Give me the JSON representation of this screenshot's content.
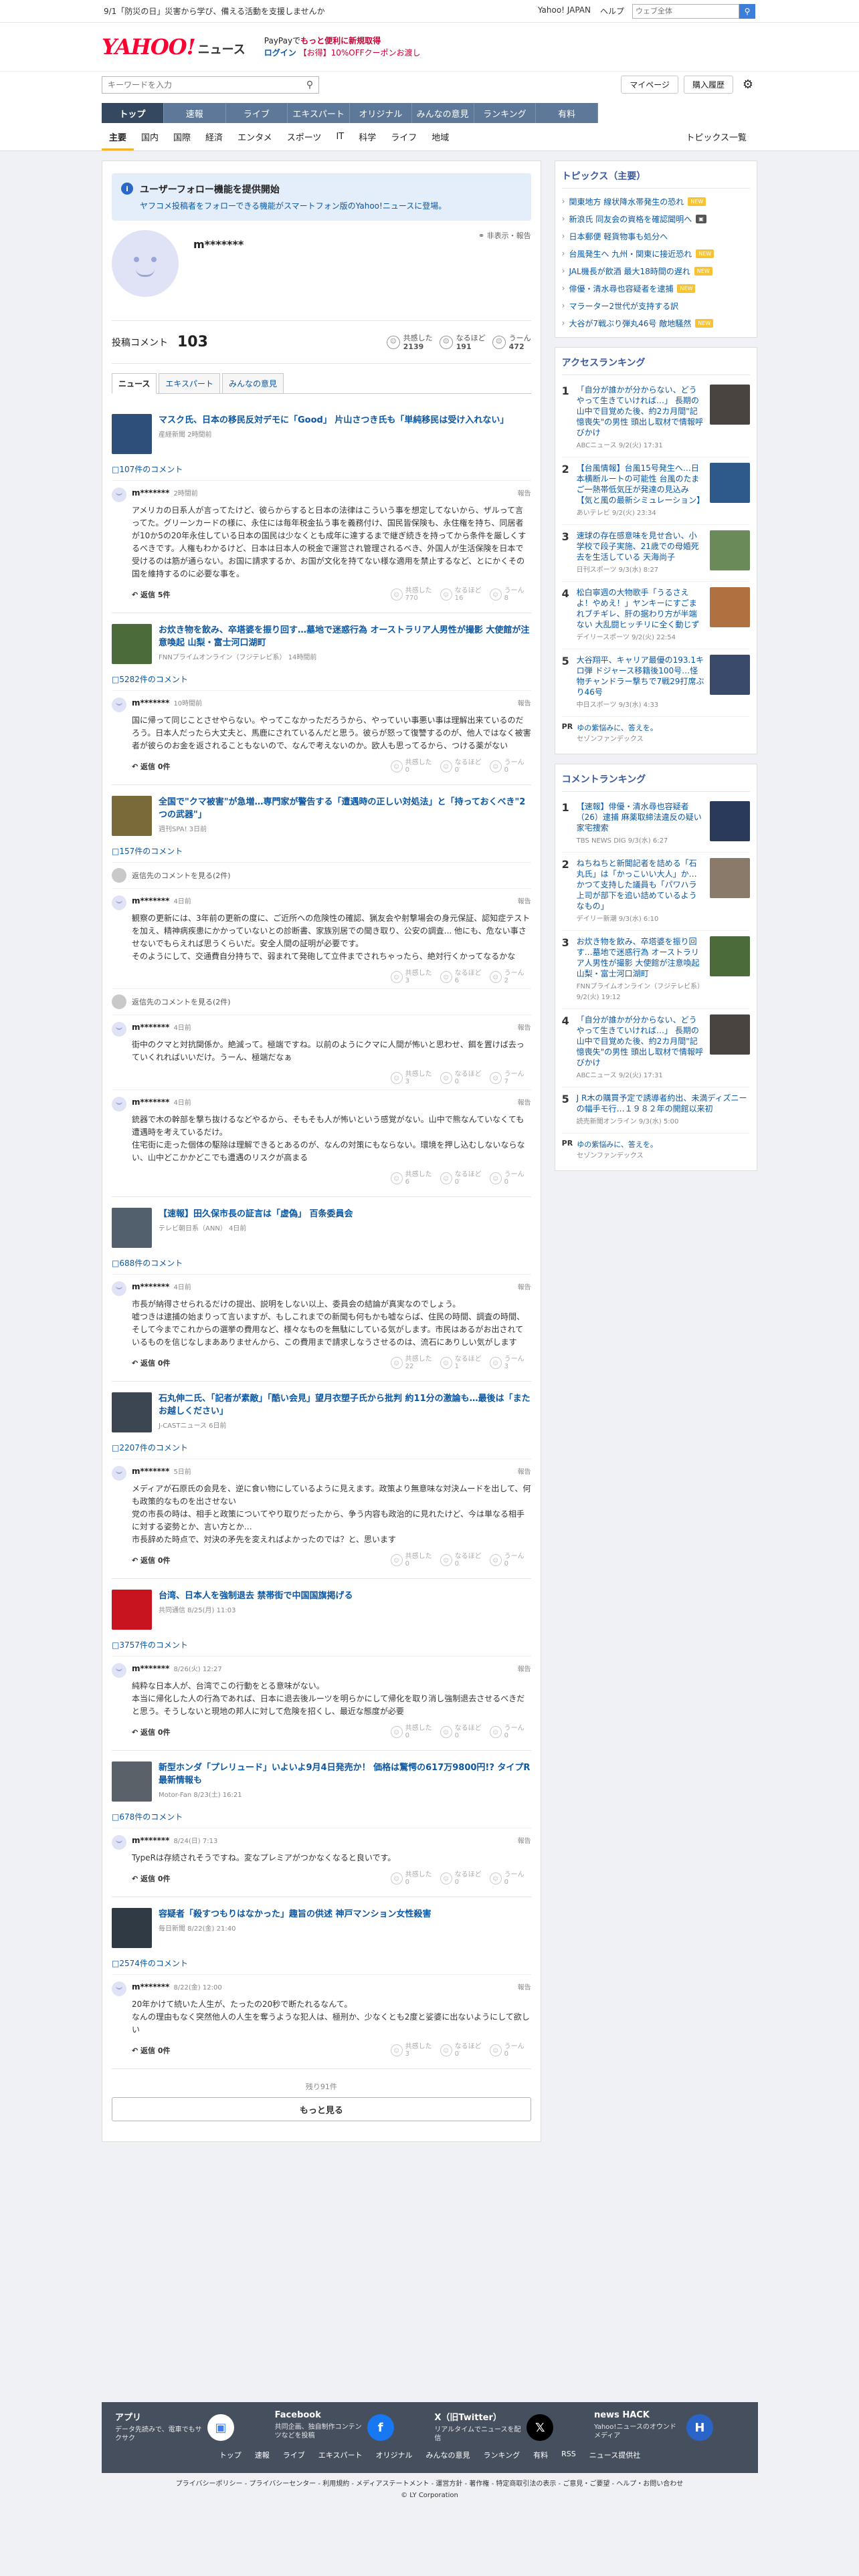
{
  "topbar": {
    "notice": "9/1「防災の日」災害から学び、備える活動を支援しませんか",
    "links": [
      "Yahoo! JAPAN",
      "ヘルプ"
    ],
    "search_placeholder": "ウェブ全体",
    "icon": "search-icon"
  },
  "header": {
    "logo": "YAHOO!",
    "logo_sub": "JAPAN",
    "service": "ニュース",
    "promo_line1_prefix": "PayPayで",
    "promo_line1_em": "もっと便利に新規取得",
    "promo_login": "ログイン",
    "promo_coupon": "【お得】10%OFFクーポンお渡し"
  },
  "search": {
    "placeholder": "キーワードを入力",
    "mypage": "マイページ",
    "buy": "購入履歴"
  },
  "nav": {
    "tabs": [
      "トップ",
      "速報",
      "ライブ",
      "エキスパート",
      "オリジナル",
      "みんなの意見",
      "ランキング",
      "有料"
    ],
    "active": 0
  },
  "categories": {
    "items": [
      "主要",
      "国内",
      "国際",
      "経済",
      "エンタメ",
      "スポーツ",
      "IT",
      "科学",
      "ライフ",
      "地域"
    ],
    "active": 0,
    "topics_list": "トピックス一覧"
  },
  "info": {
    "title": "ユーザーフォロー機能を提供開始",
    "desc": "ヤフコメ投稿者をフォローできる機能がスマートフォン版のYahoo!ニュースに登場。"
  },
  "profile": {
    "name": "m*******",
    "action": "非表示・報告",
    "comment_label": "投稿コメント",
    "comment_count": "103",
    "stats": [
      {
        "label": "共感した",
        "value": "2139"
      },
      {
        "label": "なるほど",
        "value": "191"
      },
      {
        "label": "うーん",
        "value": "472"
      }
    ]
  },
  "subtabs": [
    "ニュース",
    "エキスパート",
    "みんなの意見"
  ],
  "vote_labels": [
    "共感した",
    "なるほど",
    "うーん"
  ],
  "reply_label": "返信",
  "report_label": "報告",
  "blocks": [
    {
      "title": "マスク氏、日本の移民反対デモに「Good」 片山さつき氏も「単純移民は受け入れない」",
      "source": "産経新聞 2時間前",
      "thumb": "#2d4f7a",
      "count": "107件のコメント",
      "comments": [
        {
          "user": "m*******",
          "time": "2時間前",
          "text": "アメリカの日系人が言ってたけど、彼らからすると日本の法律はこういう事を想定してないから、ザルって言ってた。グリーンカードの様に、永住には毎年税金払う事を義務付け、国民皆保険も、永住権を持ち、同居者が10か5の20年永住している日本の国民は少なくとも成年に達するまで継ぎ続きを持ってから条件を厳しくするべきです。人権もわかるけど、日本は日本人の税金で運営され管理されるべき、外国人が生活保険を日本で受けるのは筋が通らない。お国に請求するか、お国が文化を持てない様な適用を禁止するなど、とにかくその国を維持するのに必要な事を。",
          "votes": [
            "770",
            "16",
            "8"
          ],
          "replies": "返信 5件"
        }
      ]
    },
    {
      "title": "お炊き物を飲み、卒塔婆を振り回す…墓地で迷惑行為 オーストラリア人男性が撮影 大使館が注意喚起 山梨・富士河口湖町",
      "source": "FNNプライムオンライン（フジテレビ系） 14時間前",
      "thumb": "#4b6b3a",
      "count": "5282件のコメント",
      "comments": [
        {
          "user": "m*******",
          "time": "10時間前",
          "text": "国に帰って同じことさせやらない。やってこなかっただろうから、やっていい事悪い事は理解出来ているのだろう。日本人だったら大丈夫と、馬鹿にされているんだと思う。彼らが怒って復讐するのが、他人ではなく被害者が彼らのお金を返されることもないので、なんで考えないのか。欧人も思ってるから、つける薬がない",
          "votes": [
            "0",
            "0",
            "0"
          ],
          "replies": "返信 0件"
        }
      ]
    },
    {
      "title": "全国で\"クマ被害\"が急増…専門家が警告する「遭遇時の正しい対処法」と「持っておくべき\"2つの武器\"」",
      "source": "週刊SPA! 3日前",
      "thumb": "#7a6a3a",
      "count": "157件のコメント",
      "pre_reply": "返信先のコメントを見る(2件)",
      "comments": [
        {
          "user": "m*******",
          "time": "4日前",
          "text": "観察の更新には、3年前の更新の度に、ご近所への危険性の確認、猟友会や射撃場会の身元保証、認知症テストを加え、精神病疾患にかかっていないとの診断書、家族別居での聞き取り、公安の調査... 他にも、危ない事させないでもらえれば思うくらいだ。安全人間の証明が必要です。\nそのようにして、交通費自分持ちで、弱まれて発砲して立件までされちゃったら、絶対行くかってなるかな",
          "votes": [
            "3",
            "6",
            "2"
          ]
        }
      ],
      "pre_reply2": "返信先のコメントを見る(2件)",
      "comments2": [
        {
          "user": "m*******",
          "time": "4日前",
          "text": "街中のクマと対抗関係か。絶滅って。極端ですね。以前のようにクマに人間が怖いと思わせ、餌を置けば去っていくれればいいだけ。うーん、極端だなぁ",
          "votes": [
            "3",
            "0",
            "7"
          ]
        },
        {
          "user": "m*******",
          "time": "4日前",
          "text": "銃器で木の幹部を撃ち抜けるなどやるから、そもそも人が怖いという感覚がない。山中で熊なんていなくても遭遇時を考えているだけ。\n住宅街に走った個体の駆除は理解できるとあるのが、なんの対策にもならない。環境を押し込むしないならない、山中どこかかどこでも遭遇のリスクが高まる",
          "votes": [
            "6",
            "0",
            "0"
          ]
        }
      ]
    },
    {
      "title": "【速報】田久保市長の証言は「虚偽」 百条委員会",
      "source": "テレビ朝日系（ANN） 4日前",
      "thumb": "#52606e",
      "count": "688件のコメント",
      "comments": [
        {
          "user": "m*******",
          "time": "4日前",
          "text": "市長が納得させられるだけの提出、説明をしない以上、委員会の結論が真実なのでしょう。\n嘘つきは逮捕の始まりって言いますが、もしこれまでの新聞も何もかも嘘ならば、住民の時間、調査の時間、そして今までこれからの選挙の費用など、様々なものを無駄にしている気がします。市民はあるがお出されているものを信じなしまあありませんから、この費用まで請求しなうさせるのは、流石にありしい気がします",
          "votes": [
            "22",
            "1",
            "3"
          ],
          "replies": "返信 0件"
        }
      ]
    },
    {
      "title": "石丸伸二氏、「記者が素敵」「酷い会見」望月衣塑子氏から批判 約11分の激論も…最後は「またお越しください」",
      "source": "J-CASTニュース 6日前",
      "thumb": "#3b4652",
      "count": "2207件のコメント",
      "comments": [
        {
          "user": "m*******",
          "time": "5日前",
          "text": "メディアが石原氏の会見を、逆に食い物にしているように見えます。政策より無意味な対決ムードを出して、何も政策的なものを出させない\n党の市長の時は、相手と政策についてやり取りだったから、争う内容も政治的に見れたけど、今は単なる相手に対する姿勢とか、言い方とか…\n市長辞めた時点で、対決の矛先を変えればよかったのでは？と、思います",
          "votes": [
            "0",
            "0",
            "0"
          ],
          "replies": "返信 0件"
        }
      ]
    },
    {
      "title": "台湾、日本人を強制退去 禁帯街で中国国旗掲げる",
      "source": "共同通信 8/25(月) 11:03",
      "thumb": "#c8141e",
      "count": "3757件のコメント",
      "comments": [
        {
          "user": "m*******",
          "time": "8/26(火) 12:27",
          "text": "純粋な日本人が、台湾でこの行動をとる意味がない。\n本当に帰化した人の行為であれば、日本に退去後ルーツを明らかにして帰化を取り消し強制退去させるべきだと思う。そうしないと現地の邦人に対して危険を招くし、最近な態度が必要",
          "votes": [
            "0",
            "0",
            "0"
          ],
          "replies": "返信 0件"
        }
      ]
    },
    {
      "title": "新型ホンダ「プレリュード」いよいよ9月4日発売か！ 価格は驚愕の617万9800円!? タイプR最新情報も",
      "source": "Motor-Fan 8/23(土) 16:21",
      "thumb": "#5a6168",
      "count": "678件のコメント",
      "comments": [
        {
          "user": "m*******",
          "time": "8/24(日) 7:13",
          "text": "TypeRは存続されそうですね。変なプレミアがつかなくなると良いです。",
          "votes": [
            "0",
            "0",
            "0"
          ],
          "replies": "返信 0件"
        }
      ]
    },
    {
      "title": "容疑者「殺すつもりはなかった」趣旨の供述 神戸マンション女性殺害",
      "source": "毎日新聞 8/22(金) 21:40",
      "thumb": "#2f3a44",
      "count": "2574件のコメント",
      "comments": [
        {
          "user": "m*******",
          "time": "8/22(金) 12:00",
          "text": "20年かけて続いた人生が、たったの20秒で断たれるなんて。\nなんの理由もなく突然他人の人生を奪うような犯人は、極刑か、少なくとも2度と娑婆に出ないようにして欲しい",
          "votes": [
            "3",
            "0",
            "0"
          ],
          "replies": "返信 0件"
        }
      ]
    }
  ],
  "remaining": "残り91件",
  "more_label": "もっと見る",
  "side": {
    "topics_head": "トピックス（主要）",
    "topics": [
      {
        "t": "関東地方 線状降水帯発生の恐れ",
        "b": "new"
      },
      {
        "t": "新浪氏 同友会の資格を確認聞明へ",
        "b": "img"
      },
      {
        "t": "日本郵便 軽貨物事も処分へ",
        "b": ""
      },
      {
        "t": "台風発生へ 九州・関東に接近恐れ",
        "b": "new"
      },
      {
        "t": "JAL機長が飲酒 最大18時間の遅れ",
        "b": "new"
      },
      {
        "t": "俳優・清水尋也容疑者を逮捕",
        "b": "new"
      },
      {
        "t": "マラーター2世代が支持する訳",
        "b": ""
      },
      {
        "t": "大谷が7戦ぶり弾丸46号 敵地騒然",
        "b": "new"
      }
    ],
    "access_head": "アクセスランキング",
    "access": [
      {
        "t": "「自分が誰かが分からない、どうやって生きていければ…」 長期の山中で目覚めた後、約2カ月間\"記憶喪失\"の男性 頭出し取材で情報呼びかけ",
        "s": "ABCニュース 9/2(火) 17:31",
        "c": "#4a4440"
      },
      {
        "t": "【台風情報】台風15号発生へ…日本横断ルートの可能性 台風のたまご一熱帯低気圧が発達の見込み【気と風の最新シミュレーション】",
        "s": "あいテレビ 9/2(火) 23:34",
        "c": "#2d5a8a"
      },
      {
        "t": "速球の存在感意味を見せ合い、小学校で段子実施、21歳での母婚死去を生活している 天海尚子",
        "s": "日刊スポーツ 9/3(水) 8:27",
        "c": "#6a8a5a"
      },
      {
        "t": "松白寧週の大物歌手「うるさえよ！やめえ！」ヤンキーにすごまれブチギレ、肝の据わり方が半端ない 大乱闘ヒッチリに全く動じず",
        "s": "デイリースポーツ 9/2(火) 22:54",
        "c": "#b07040"
      },
      {
        "t": "大谷翔平、キャリア最優の193.1キロ弾 ドジャース移籍後100号…怪物チャンドラー撃ちで7戦29打席ぶり46号",
        "s": "中日スポーツ 9/3(水) 4:33",
        "c": "#3a4a6a"
      }
    ],
    "pr": {
      "t": "ゆの紫悩みに、答えを。",
      "s": "セゾンファンデックス"
    },
    "comment_head": "コメントランキング",
    "cranks": [
      {
        "t": "【速報】俳優・清水尋也容疑者（26）逮捕 麻薬取締法違反の疑い 家宅捜索",
        "s": "TBS NEWS DIG 9/3(水) 6:27",
        "c": "#2a3a5a"
      },
      {
        "t": "ねちねちと新聞記者を詰める「石丸氏」は「かっこいい大人」か…かつて支持した議員も「パワハラ上司が部下を追い詰めているようなもの」",
        "s": "デイリー新潮 9/3(水) 6:10",
        "c": "#8a7a6a"
      },
      {
        "t": "お炊き物を飲み、卒塔婆を振り回す…墓地で迷惑行為 オーストラリア人男性が撮影 大使館が注意喚起 山梨・富士河口湖町",
        "s": "FNNプライムオンライン（フジテレビ系） 9/2(火) 19:12",
        "c": "#4b6b3a"
      },
      {
        "t": "「自分が誰かが分からない、どうやって生きていければ…」 長期の山中で目覚めた後、約2カ月間\"記憶喪失\"の男性 頭出し取材で情報呼びかけ",
        "s": "ABCニュース 9/2(火) 17:31",
        "c": "#4a4440"
      },
      {
        "t": "J R木の購買予定で誘導者約出、未満ディズニーの幅手モ行…１９８２年の開館以来初",
        "s": "読売新聞オンライン 9/3(水) 5:00",
        "c": ""
      }
    ]
  },
  "footer": {
    "services": [
      {
        "t": "アプリ",
        "d": "データ先読みで、電車でもサクサク",
        "i": "app-icon"
      },
      {
        "t": "Facebook",
        "d": "共同企画、独自制作コンテンツなどを投稿",
        "i": "facebook-icon"
      },
      {
        "t": "X（旧Twitter）",
        "d": "リアルタイムでニュースを配信",
        "i": "x-icon"
      },
      {
        "t": "news HACK",
        "d": "Yahoo!ニュースのオウンドメディア",
        "i": "newshack-icon"
      }
    ],
    "links": [
      "トップ",
      "速報",
      "ライブ",
      "エキスパート",
      "オリジナル",
      "みんなの意見",
      "ランキング",
      "有料",
      "RSS",
      "ニュース提供社"
    ],
    "sublinks": "プライバシーポリシー - プライバシーセンター - 利用規約 - メディアステートメント - 運営方針 - 著作権 - 特定商取引法の表示 - ご意見・ご要望 - ヘルプ・お問い合わせ",
    "copyright": "© LY Corporation"
  }
}
